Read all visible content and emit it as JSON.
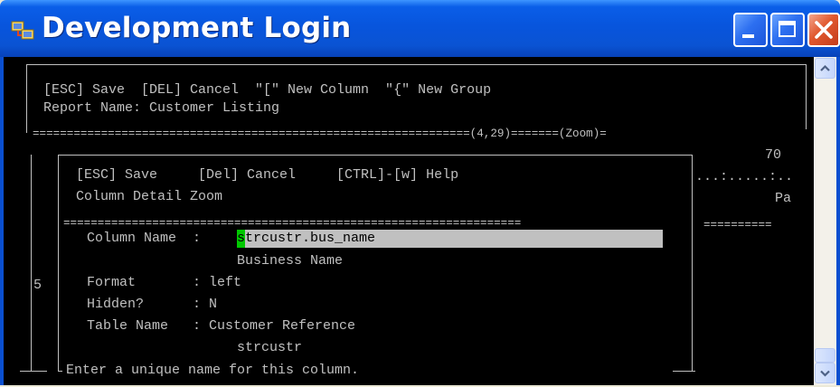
{
  "window": {
    "title": "Development Login",
    "icon": "app-icon"
  },
  "console": {
    "line1": "[ESC] Save  [DEL] Cancel  \"[\" New Column  \"{\" New Group",
    "line2": "Report Name: Customer Listing",
    "ruler": "================================================================(4,29)=======(Zoom)=",
    "right_col_70": "70",
    "right_dots": "...:.....:..",
    "right_pa": "Pa",
    "right_eq": "==========",
    "left_digit": "5"
  },
  "zoom": {
    "header": "[ESC] Save     [Del] Cancel     [CTRL]-[w] Help",
    "subtitle": "Column Detail Zoom",
    "ruler": "===================================================================",
    "column_name_label": "Column Name  : ",
    "column_name_first_char": "s",
    "column_name_rest": "trcustr.bus_name",
    "business_name": "Business Name",
    "format_label": "Format       : left",
    "hidden_label": "Hidden?      : N",
    "table_name_label": "Table Name   : Customer Reference",
    "table_name_value": "strcustr",
    "status_message": "Enter a unique name for this column."
  },
  "colors": {
    "titlebar": "#0A55DD",
    "console_bg": "#000000",
    "console_fg": "#C0C0C0",
    "field_bg": "#C0C0C0",
    "cursor": "#00C800"
  }
}
